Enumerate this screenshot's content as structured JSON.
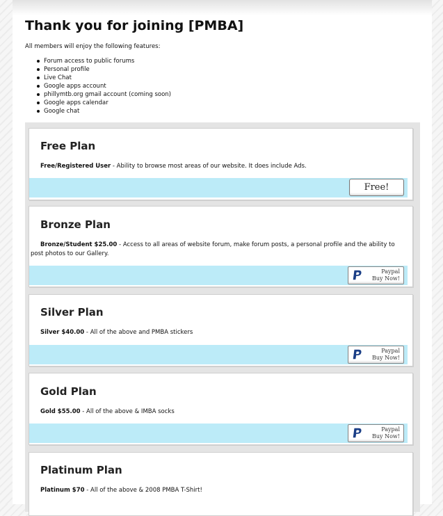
{
  "header": {
    "title": "Thank you for joining [PMBA]",
    "intro": "All members will enjoy the following features:"
  },
  "features": [
    "Forum access to public forums",
    "Personal profile",
    "Live Chat",
    "Google apps account",
    "phillymtb.org gmail account (coming soon)",
    "Google apps calendar",
    "Google chat"
  ],
  "plans": [
    {
      "title": "Free Plan",
      "name": "Free/Registered User",
      "desc": " - Ability to browse most areas of our website. It does include Ads.",
      "button": "Free!"
    },
    {
      "title": "Bronze Plan",
      "name": "Bronze/Student $25.00",
      "desc": " - Access to all areas of website forum, make forum posts, a personal profile and the ability to post photos to our Gallery.",
      "button_top": "Paypal",
      "button_bottom": "Buy Now!"
    },
    {
      "title": "Silver Plan",
      "name": "Silver $40.00",
      "desc": " - All of the above and PMBA stickers",
      "button_top": "Paypal",
      "button_bottom": "Buy Now!"
    },
    {
      "title": "Gold Plan",
      "name": "Gold $55.00",
      "desc": " - All of the above & IMBA socks",
      "button_top": "Paypal",
      "button_bottom": "Buy Now!"
    },
    {
      "title": "Platinum Plan",
      "name": "Platinum $70",
      "desc": " - All of the above & 2008 PMBA T-Shirt!"
    }
  ],
  "icons": {
    "paypal": "paypal-icon"
  },
  "colors": {
    "plan_bar": "#bcebf8",
    "paypal_blue": "#1a3e86"
  }
}
